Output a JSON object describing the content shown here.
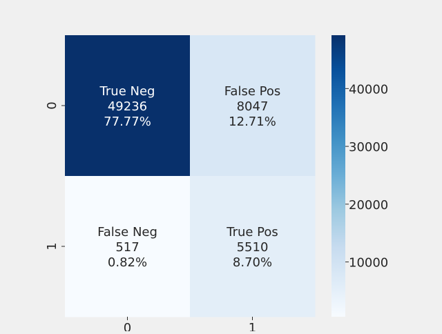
{
  "chart_data": {
    "type": "heatmap",
    "x_ticks": [
      "0",
      "1"
    ],
    "y_ticks": [
      "0",
      "1"
    ],
    "cells": [
      {
        "row": 0,
        "col": 0,
        "label": "True Neg",
        "count": "49236",
        "percent": "77.77%",
        "value": 49236
      },
      {
        "row": 0,
        "col": 1,
        "label": "False Pos",
        "count": "8047",
        "percent": "12.71%",
        "value": 8047
      },
      {
        "row": 1,
        "col": 0,
        "label": "False Neg",
        "count": "517",
        "percent": "0.82%",
        "value": 517
      },
      {
        "row": 1,
        "col": 1,
        "label": "True Pos",
        "count": "5510",
        "percent": "8.70%",
        "value": 5510
      }
    ],
    "colorbar": {
      "vmin": 517,
      "vmax": 49236,
      "ticks": [
        10000,
        20000,
        30000,
        40000
      ],
      "tick_labels": [
        "10000",
        "20000",
        "30000",
        "40000"
      ],
      "colormap": "Blues"
    },
    "colors": {
      "background": "#f0f0f0",
      "text_dark": "#262626",
      "text_light": "#ffffff"
    }
  }
}
